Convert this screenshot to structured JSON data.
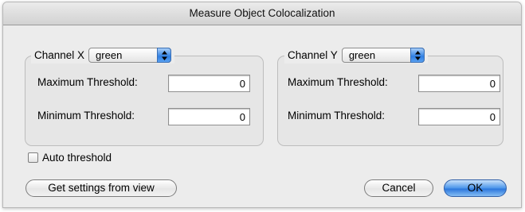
{
  "window": {
    "title": "Measure Object Colocalization"
  },
  "channel_x": {
    "label": "Channel X",
    "selected": "green",
    "max_threshold_label": "Maximum Threshold:",
    "max_threshold_value": "0",
    "min_threshold_label": "Minimum Threshold:",
    "min_threshold_value": "0"
  },
  "channel_y": {
    "label": "Channel Y",
    "selected": "green",
    "max_threshold_label": "Maximum Threshold:",
    "max_threshold_value": "0",
    "min_threshold_label": "Minimum Threshold:",
    "min_threshold_value": "0"
  },
  "auto_threshold": {
    "label": "Auto threshold",
    "checked": false
  },
  "buttons": {
    "get_settings": "Get settings from view",
    "cancel": "Cancel",
    "ok": "OK"
  },
  "colors": {
    "accent": "#3b86e6",
    "background": "#ececec"
  },
  "icons": {
    "popup_arrows": "up-down-arrows-icon"
  }
}
